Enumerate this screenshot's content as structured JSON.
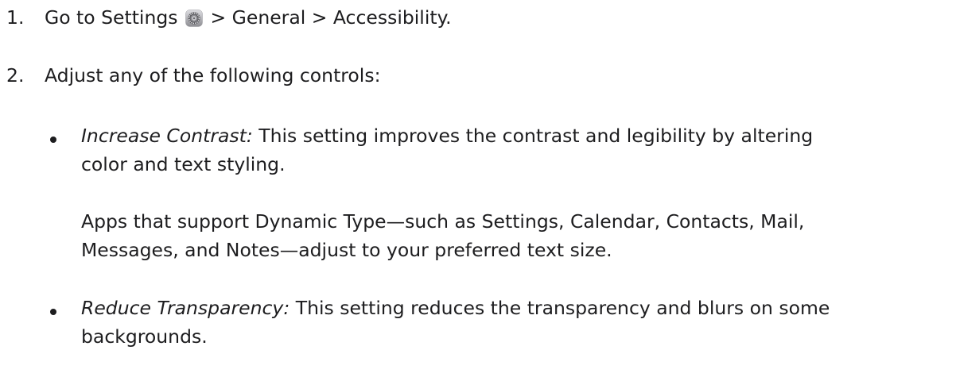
{
  "colors": {
    "text": "#1d1d1f",
    "background": "#ffffff"
  },
  "step1": {
    "number": "1.",
    "text_before_icon": "Go to Settings",
    "icon": "settings-gear-icon",
    "text_after_icon": "> General > Accessibility."
  },
  "step2": {
    "number": "2.",
    "text": "Adjust any of the following controls:"
  },
  "items": [
    {
      "term": "Increase Contrast:",
      "line1_rest": " This setting improves the contrast and legibility by altering",
      "line2": "color and text styling.",
      "note_line1": "Apps that support Dynamic Type—such as Settings, Calendar, Contacts, Mail,",
      "note_line2": "Messages, and Notes—adjust to your preferred text size."
    },
    {
      "term": "Reduce Transparency:",
      "line1_rest": " This setting reduces the transparency and blurs on some",
      "line2": "backgrounds."
    }
  ]
}
